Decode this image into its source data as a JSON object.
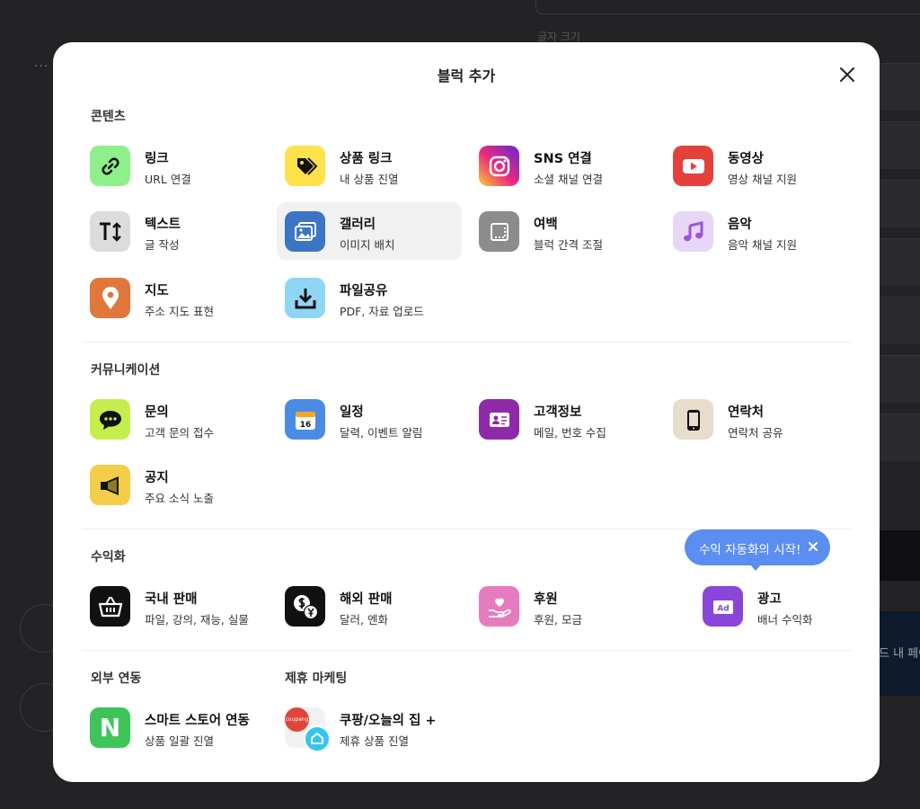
{
  "modal": {
    "title": "블럭 추가"
  },
  "sections": {
    "contents": {
      "label": "콘텐츠",
      "items": [
        {
          "name": "링크",
          "desc": "URL 연결",
          "icon": "link-icon",
          "color": "#8ef08a"
        },
        {
          "name": "상품 링크",
          "desc": "내 상품 진열",
          "icon": "tag-icon",
          "color": "#ffe14a"
        },
        {
          "name": "SNS 연결",
          "desc": "소셜 채널 연결",
          "icon": "instagram-icon",
          "color": "#d6249f"
        },
        {
          "name": "동영상",
          "desc": "영상 채널 지원",
          "icon": "play-icon",
          "color": "#e4413b"
        },
        {
          "name": "텍스트",
          "desc": "글 작성",
          "icon": "text-size-icon",
          "color": "#dcdcdc"
        },
        {
          "name": "갤러리",
          "desc": "이미지 배치",
          "icon": "gallery-icon",
          "color": "#3b75c4"
        },
        {
          "name": "여백",
          "desc": "블럭 간격 조절",
          "icon": "spacing-icon",
          "color": "#8c8c8c"
        },
        {
          "name": "음악",
          "desc": "음악 채널 지원",
          "icon": "music-icon",
          "color": "#e8d6f7"
        },
        {
          "name": "지도",
          "desc": "주소 지도 표현",
          "icon": "map-pin-icon",
          "color": "#e0773c"
        },
        {
          "name": "파일공유",
          "desc": "PDF, 자료 업로드",
          "icon": "download-icon",
          "color": "#8fd6f5"
        }
      ]
    },
    "communication": {
      "label": "커뮤니케이션",
      "items": [
        {
          "name": "문의",
          "desc": "고객 문의 접수",
          "icon": "chat-bubble-icon",
          "color": "#c5ee4c"
        },
        {
          "name": "일정",
          "desc": "달력, 이벤트 알림",
          "icon": "calendar-icon",
          "color": "#4a8be6"
        },
        {
          "name": "고객정보",
          "desc": "메일, 번호 수집",
          "icon": "id-card-icon",
          "color": "#8e2aa8"
        },
        {
          "name": "연락처",
          "desc": "연락처 공유",
          "icon": "phone-icon",
          "color": "#e8dccb"
        },
        {
          "name": "공지",
          "desc": "주요 소식 노출",
          "icon": "megaphone-icon",
          "color": "#f4cd4a"
        }
      ]
    },
    "monetization": {
      "label": "수익화",
      "items": [
        {
          "name": "국내 판매",
          "desc": "파일, 강의, 재능, 실물",
          "icon": "basket-icon",
          "color": "#111111"
        },
        {
          "name": "해외 판매",
          "desc": "달러, 엔화",
          "icon": "currency-icon",
          "color": "#111111"
        },
        {
          "name": "후원",
          "desc": "후원, 모금",
          "icon": "heart-hand-icon",
          "color": "#e77bbf"
        },
        {
          "name": "광고",
          "desc": "배너 수익화",
          "icon": "ad-icon",
          "color": "#8a45d9"
        }
      ],
      "calendar_day": "16",
      "ad_badge": "Ad"
    },
    "external": {
      "label": "외부 연동",
      "items": [
        {
          "name": "스마트 스토어 연동",
          "desc": "상품 일괄 진열",
          "icon": "naver-icon",
          "color": "#3fc45a"
        }
      ],
      "naver_letter": "N"
    },
    "affiliate": {
      "label": "제휴 마케팅",
      "items": [
        {
          "name": "쿠팡/오늘의 집 +",
          "desc": "제휴 상품 진열",
          "icon": "coupang-ohouse-icon",
          "color": "#f2f2f2"
        }
      ],
      "coupang_text": "coupang"
    }
  },
  "tooltip": {
    "text": "수익 자동화의 시작!"
  },
  "background": {
    "dots": "...",
    "label": "글자 크기",
    "navy_text": "드 내 페이"
  }
}
